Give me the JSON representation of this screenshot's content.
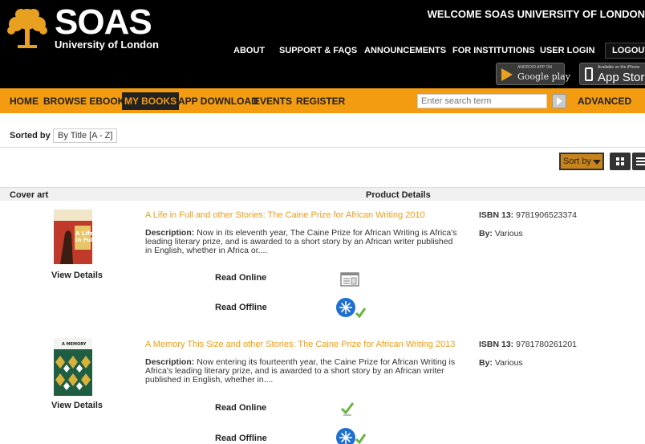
{
  "brand": {
    "name": "SOAS",
    "subtitle": "University of London"
  },
  "welcome": "WELCOME SOAS UNIVERSITY OF LONDON",
  "top_nav": [
    "ABOUT",
    "SUPPORT & FAQS",
    "ANNOUNCEMENTS",
    "FOR INSTITUTIONS",
    "USER LOGIN",
    "LOGOUT"
  ],
  "stores": {
    "google": {
      "small": "ANDROID APP ON",
      "big": "Google play"
    },
    "apple": {
      "small": "Available on the iPhone",
      "big": "App Store"
    }
  },
  "main_nav": [
    "HOME",
    "BROWSE EBOOKS",
    "MY BOOKS",
    "APP DOWNLOAD",
    "EVENTS",
    "REGISTER"
  ],
  "main_nav_active": "MY BOOKS",
  "search": {
    "placeholder": "Enter search term",
    "advanced": "ADVANCED"
  },
  "sort": {
    "label": "Sorted by",
    "value": "By Title [A - Z]",
    "button": "Sort by"
  },
  "table": {
    "col_cover": "Cover art",
    "col_details": "Product Details"
  },
  "books": [
    {
      "title": "A Life in Full and other Stories: The Caine Prize for African Writing 2010",
      "description_label": "Description:",
      "description": "Now in its eleventh year, The Caine Prize for African Writing is Africa's leading literary prize, and is awarded to a short story by an African writer published in English, whether in Africa or....",
      "isbn_label": "ISBN 13:",
      "isbn": "9781906523374",
      "by_label": "By:",
      "by": "Various",
      "view_details": "View Details",
      "read_online": "Read Online",
      "read_offline": "Read Offline"
    },
    {
      "title": "A Memory This Size and other Stories: The Caine Prize for African Writing 2013",
      "description_label": "Description:",
      "description": "Now entering its fourteenth year, the Caine Prize for African Writing is Africa's leading literary prize, and is awarded to a short story by an African writer published in English, whether in....",
      "isbn_label": "ISBN 13:",
      "isbn": "9781780261201",
      "by_label": "By:",
      "by": "Various",
      "view_details": "View Details",
      "read_online": "Read Online",
      "read_offline": "Read Offline"
    }
  ],
  "colors": {
    "accent": "#f39c12",
    "header_bg": "#000000",
    "active_bg": "#222222"
  }
}
